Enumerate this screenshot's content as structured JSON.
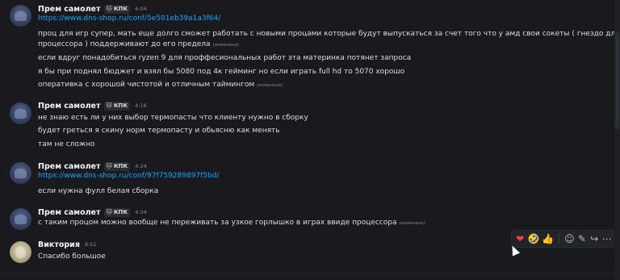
{
  "messages": [
    {
      "user": "Прем самолет",
      "tag": "КПК",
      "time": "4:04",
      "lines": [
        {
          "type": "link",
          "text": "https://www.dns-shop.ru/conf/5e501eb39a1a3f64/"
        },
        {
          "type": "text",
          "text": "проц для игр супер, мать еще долго сможет работать с новыми процами которые будут выпускаться за счет того что у амд свои сокеты ( гнездо для"
        },
        {
          "type": "text",
          "text": "процессора ) поддерживают до его предела",
          "edited": "(изменено)"
        },
        {
          "type": "text",
          "text": "если вдруг понадобиться ryzen 9 для проффесиональных работ эта материнка потянет запроса"
        },
        {
          "type": "text",
          "text": "я бы при поднял бюджет и взял бы 5080 под 4к гейминг но если играть full hd то 5070 хорошо"
        },
        {
          "type": "text",
          "text": "оперативка с хорошой чистотой и отличным таймингом",
          "edited": "(изменено)"
        }
      ]
    },
    {
      "user": "Прем самолет",
      "tag": "КПК",
      "time": "4:16",
      "lines": [
        {
          "type": "text",
          "text": "не знаю есть ли у них выбор термопасты что клиенту нужно в сборку"
        },
        {
          "type": "text",
          "text": "будет греться я скину норм термопасту и обьясню как менять"
        },
        {
          "type": "text",
          "text": "там не сложно"
        }
      ]
    },
    {
      "user": "Прем самолет",
      "tag": "КПК",
      "time": "4:24",
      "lines": [
        {
          "type": "link",
          "text": "https://www.dns-shop.ru/conf/97f759289897f5bd/"
        },
        {
          "type": "text",
          "text": "если нужна фулл белая сборка"
        }
      ]
    },
    {
      "user": "Прем самолет",
      "tag": "КПК",
      "time": "4:34",
      "lines": [
        {
          "type": "text",
          "text": "с таким процом можно вообще не переживать за узкое горлышко в играх ввиде процессора",
          "edited": "(изменено)"
        }
      ]
    },
    {
      "user": "Виктория",
      "time": "8:51",
      "lines": [
        {
          "type": "text",
          "text": "Спасибо большое"
        }
      ]
    }
  ],
  "tag_icon": "cat-face-icon",
  "action_bar": {
    "icons": [
      "heart-icon",
      "laughing-face-icon",
      "thumbs-up-icon",
      "add-reaction-icon",
      "edit-icon",
      "reply-arrow-icon",
      "more-icon"
    ],
    "glyphs": [
      "❤",
      "🤣",
      "👍",
      "☺",
      "✎",
      "↪",
      "⋯"
    ]
  },
  "colors": {
    "background": "#1a1a1e",
    "link": "#00a8fc",
    "username": "#f2f3f5",
    "text": "#dbdee1"
  }
}
